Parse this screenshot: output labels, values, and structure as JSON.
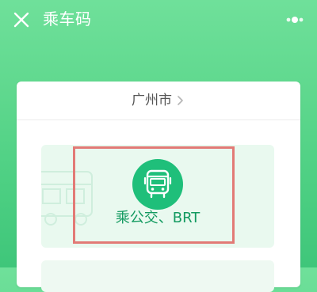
{
  "header": {
    "title": "乘车码",
    "close_icon": "close-icon",
    "more_icon": "more-options-icon"
  },
  "card": {
    "city": "广州市",
    "city_chevron_icon": "chevron-right-icon"
  },
  "options": [
    {
      "label": "乘公交、BRT",
      "icon": "bus-icon",
      "highlighted": true
    }
  ],
  "colors": {
    "header_gradient_top": "#6fe09a",
    "header_gradient_bottom": "#3fc67a",
    "bus_icon_circle": "#1fbf7a",
    "option_label_text": "#139a60",
    "option_panel_bg": "#e9f9ef",
    "highlight_border": "#e27a76"
  }
}
